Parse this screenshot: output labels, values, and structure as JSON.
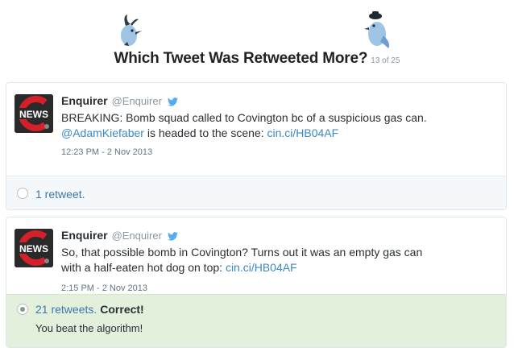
{
  "header": {
    "title": "Which Tweet Was Retweeted More?",
    "progress": "13 of 25"
  },
  "tweets": [
    {
      "avatar_text": "NEWS",
      "name": "Enquirer",
      "handle": "@Enquirer",
      "text_line1": "BREAKING: Bomb squad called to Covington bc of a suspicious gas can.",
      "mention": "@AdamKiefaber",
      "text_line2_mid": " is headed to the scene: ",
      "link": "cin.ci/HB04AF",
      "time": "12:23 PM - 2 Nov 2013",
      "retweets": "1 retweet."
    },
    {
      "avatar_text": "NEWS",
      "name": "Enquirer",
      "handle": "@Enquirer",
      "text_line1": "So, that possible bomb in Covington? Turns out it was an empty gas can",
      "text_line2": "with a half-eaten hot dog on top: ",
      "link": "cin.ci/HB04AF",
      "time": "2:15 PM - 2 Nov 2013",
      "retweets": "21 retweets.",
      "result": "Correct!",
      "result_sub": "You beat the algorithm!"
    }
  ],
  "colors": {
    "link": "#3b88c3",
    "correct_bg": "#e3f0dc",
    "neutral_bg": "#f5f8fa",
    "bird": "#9ec4e6"
  }
}
